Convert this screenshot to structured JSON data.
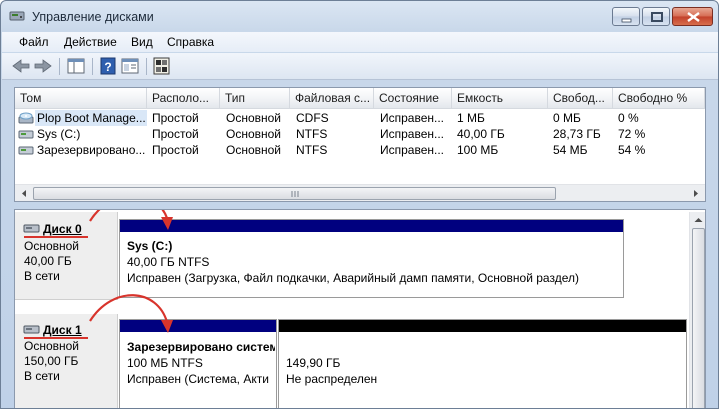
{
  "window": {
    "title": "Управление дисками"
  },
  "menu": [
    "Файл",
    "Действие",
    "Вид",
    "Справка"
  ],
  "columns": [
    "Том",
    "Располо...",
    "Тип",
    "Файловая с...",
    "Состояние",
    "Емкость",
    "Свобод...",
    "Свободно %"
  ],
  "volumes": [
    {
      "name": "Plop Boot Manage...",
      "layout": "Простой",
      "type": "Основной",
      "fs": "CDFS",
      "status": "Исправен...",
      "capacity": "1 МБ",
      "free": "0 МБ",
      "free_pct": "0 %",
      "icon": "cd-drive-icon",
      "selected": true
    },
    {
      "name": "Sys (C:)",
      "layout": "Простой",
      "type": "Основной",
      "fs": "NTFS",
      "status": "Исправен...",
      "capacity": "40,00 ГБ",
      "free": "28,73 ГБ",
      "free_pct": "72 %",
      "icon": "volume-icon"
    },
    {
      "name": "Зарезервировано...",
      "layout": "Простой",
      "type": "Основной",
      "fs": "NTFS",
      "status": "Исправен...",
      "capacity": "100 МБ",
      "free": "54 МБ",
      "free_pct": "54 %",
      "icon": "volume-icon"
    }
  ],
  "disks": [
    {
      "name": "Диск 0",
      "kind": "Основной",
      "size": "40,00 ГБ",
      "state": "В сети",
      "partitions": [
        {
          "title": "Sys  (C:)",
          "size": "40,00 ГБ NTFS",
          "status": "Исправен (Загрузка, Файл подкачки, Аварийный дамп памяти, Основной раздел)",
          "bar_color": "#00007f"
        }
      ]
    },
    {
      "name": "Диск 1",
      "kind": "Основной",
      "size": "150,00 ГБ",
      "state": "В сети",
      "partitions": [
        {
          "title": "Зарезервировано систем",
          "size": "100 МБ NTFS",
          "status": "Исправен (Система, Акти",
          "bar_color": "#00007f"
        },
        {
          "title": "",
          "size": "149,90 ГБ",
          "status": "Не распределен",
          "bar_color": "#000000"
        }
      ]
    }
  ],
  "colors": {
    "annotation": "#d8342c",
    "primary_partition": "#00007f",
    "unallocated": "#000000"
  }
}
